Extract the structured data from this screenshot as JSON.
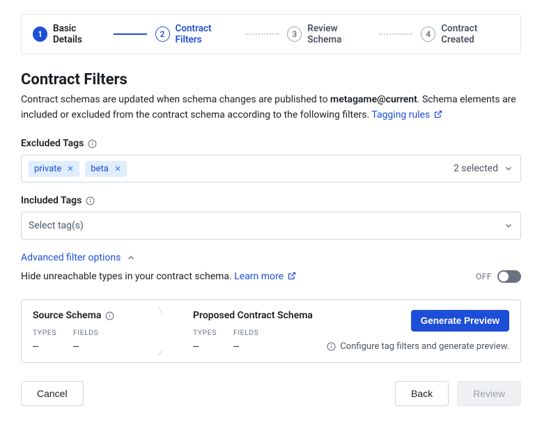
{
  "stepper": {
    "steps": [
      {
        "num": "1",
        "label": "Basic Details"
      },
      {
        "num": "2",
        "label": "Contract Filters"
      },
      {
        "num": "3",
        "label": "Review Schema"
      },
      {
        "num": "4",
        "label": "Contract Created"
      }
    ]
  },
  "page": {
    "title": "Contract Filters",
    "subtitle_pre": "Contract schemas are updated when schema changes are published to ",
    "subtitle_target": "metagame@current",
    "subtitle_post": ". Schema elements are included or excluded from the contract schema according to the following filters. ",
    "tagging_rules": "Tagging rules"
  },
  "excluded": {
    "label": "Excluded Tags",
    "tags": [
      "private",
      "beta"
    ],
    "summary": "2 selected"
  },
  "included": {
    "label": "Included Tags",
    "placeholder": "Select tag(s)"
  },
  "advanced": {
    "toggle_label": "Advanced filter options",
    "hide_text": "Hide unreachable types in your contract schema. ",
    "learn_more": "Learn more",
    "switch_state": "OFF"
  },
  "schema": {
    "source_title": "Source Schema",
    "proposed_title": "Proposed Contract Schema",
    "types_label": "TYPES",
    "fields_label": "FIELDS",
    "placeholder": "--",
    "generate_label": "Generate Preview",
    "hint": "Configure tag filters and generate preview."
  },
  "footer": {
    "cancel": "Cancel",
    "back": "Back",
    "review": "Review"
  }
}
